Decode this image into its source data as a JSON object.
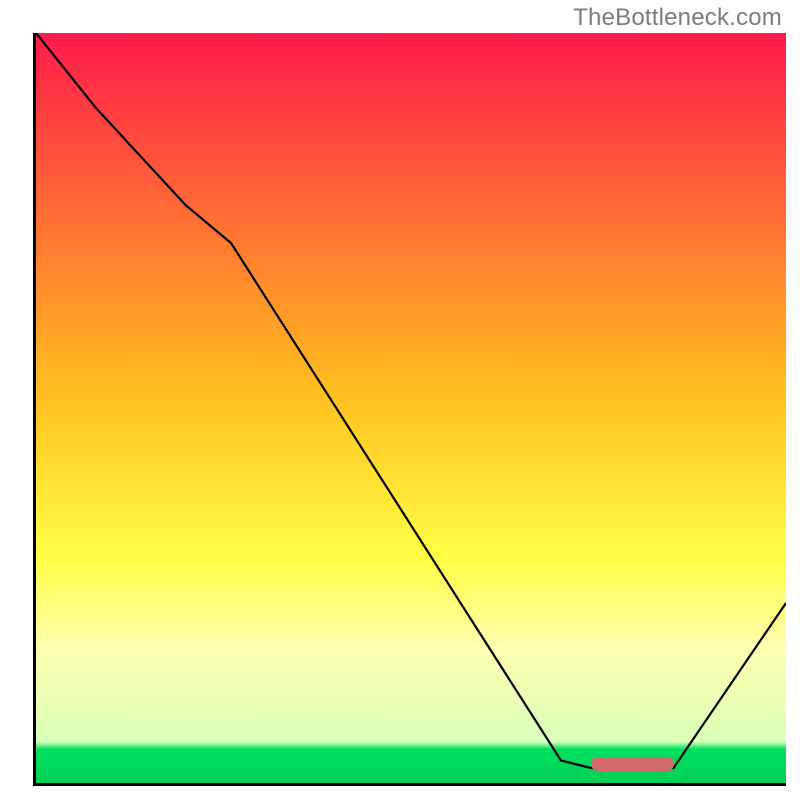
{
  "watermark": "TheBottleneck.com",
  "chart_data": {
    "type": "line",
    "title": "",
    "xlabel": "",
    "ylabel": "",
    "xlim": [
      0,
      100
    ],
    "ylim": [
      0,
      100
    ],
    "grid": false,
    "legend": false,
    "annotations": [],
    "background_gradient_stops": [
      {
        "pos": 0,
        "color": "#ff1a4b"
      },
      {
        "pos": 48,
        "color": "#ffbf1e"
      },
      {
        "pos": 70,
        "color": "#ffff45"
      },
      {
        "pos": 82,
        "color": "#ffffb0"
      },
      {
        "pos": 94.5,
        "color": "#d8ffb8"
      },
      {
        "pos": 95.5,
        "color": "#00e060"
      },
      {
        "pos": 100,
        "color": "#00d058"
      }
    ],
    "series": [
      {
        "name": "bottleneck-curve",
        "x": [
          0,
          8,
          20,
          26,
          70,
          74,
          85,
          100
        ],
        "y": [
          100,
          90,
          77,
          72,
          3,
          2,
          2,
          24
        ]
      }
    ],
    "optimum_marker": {
      "x_start": 74,
      "x_end": 85,
      "y": 2.5,
      "color": "#d46a6b"
    }
  }
}
